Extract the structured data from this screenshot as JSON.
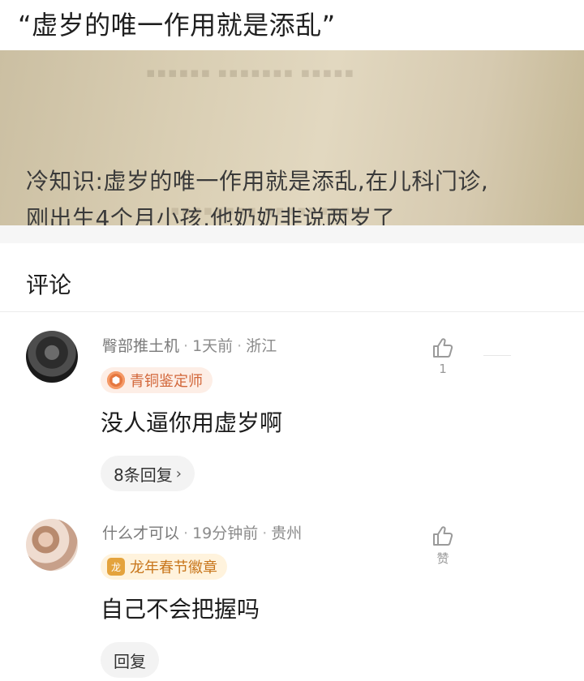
{
  "post": {
    "title": "“虚岁的唯一作用就是添乱”",
    "image_lines": [
      "冷知识:虚岁的唯一作用就是添乱,在儿科门诊,",
      "刚出生4个月小孩,他奶奶非说两岁了"
    ]
  },
  "comments_section": {
    "heading": "评论",
    "comments": [
      {
        "username": "臀部推土机",
        "time": "1天前",
        "location": "浙江",
        "badge": "青铜鉴定师",
        "text": "没人逼你用虚岁啊",
        "reply_label": "8条回复",
        "likes": "1"
      },
      {
        "username": "什么才可以",
        "time": "19分钟前",
        "location": "贵州",
        "badge": "龙年春节徽章",
        "text": "自己不会把握吗",
        "reply_label": "回复",
        "likes": "赞"
      }
    ]
  },
  "icons": {
    "like": "thumbs-up-icon",
    "reply_more": "chevron-right-icon",
    "bronze_badge": "hexagon-badge-icon",
    "festival_badge": "dragon-badge-icon"
  },
  "colors": {
    "bronze_badge_bg": "#fdeee6",
    "bronze_badge_text": "#d2673a",
    "festival_badge_bg": "#fff3dd",
    "festival_badge_text": "#c8761c"
  }
}
